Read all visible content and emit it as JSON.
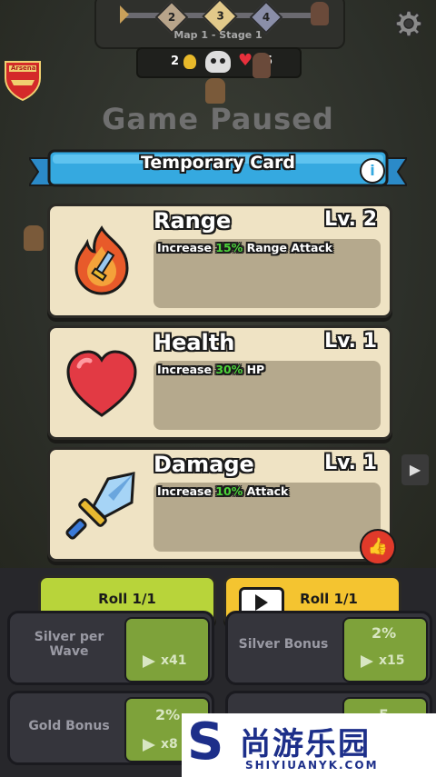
{
  "hud": {
    "map_label": "Map 1 - Stage 1",
    "stages": [
      "2",
      "3",
      "4"
    ],
    "coins": "2",
    "lives": "35",
    "badge_text": "Arsenal"
  },
  "title": "Game Paused",
  "dialog": {
    "header": "Temporary Card",
    "cards": [
      {
        "name": "Range",
        "level": "Lv. 2",
        "desc_pre": "Increase ",
        "desc_value": "15%",
        "desc_post": " Range Attack",
        "icon": "flame-sword-icon"
      },
      {
        "name": "Health",
        "level": "Lv. 1",
        "desc_pre": "Increase ",
        "desc_value": "30%",
        "desc_post": " HP",
        "icon": "heart-icon"
      },
      {
        "name": "Damage",
        "level": "Lv. 1",
        "desc_pre": "Increase ",
        "desc_value": "10%",
        "desc_post": " Attack",
        "icon": "sword-icon"
      }
    ],
    "roll_button": "Roll 1/1",
    "roll_ad_button": "Roll 1/1"
  },
  "upgrades": [
    {
      "label": "Silver per Wave",
      "cost": "x41"
    },
    {
      "label": "Silver Bonus",
      "value": "2%",
      "cost": "x15"
    },
    {
      "label": "Gold Bonus",
      "value": "2%",
      "cost": "x8"
    },
    {
      "label": "",
      "value": "5"
    }
  ],
  "watermark": {
    "brand": "尚游乐园",
    "url": "SHIYIUANYK.COM"
  },
  "colors": {
    "card_bg": "#efe3c4",
    "ribbon": "#35a9e0",
    "green_btn": "#b8d43a",
    "yellow_btn": "#f4c430",
    "highlight": "#4cd33a"
  }
}
